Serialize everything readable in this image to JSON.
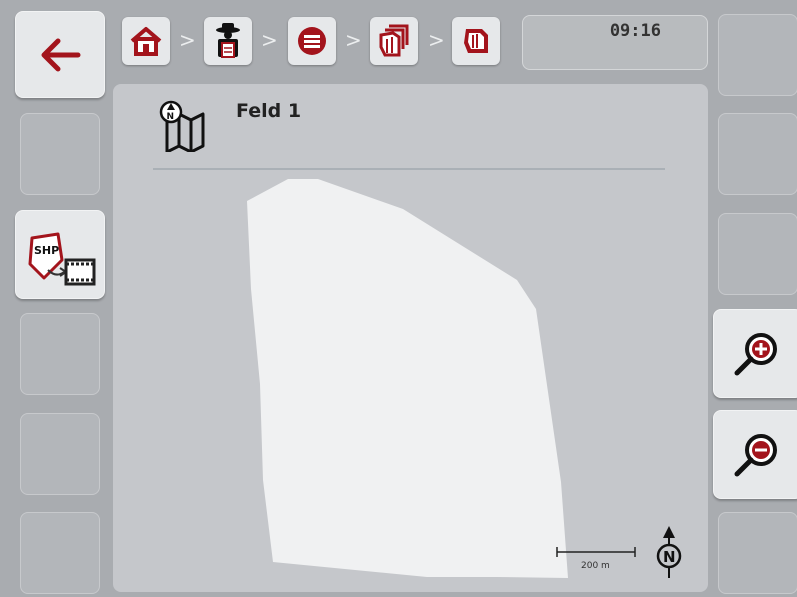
{
  "header": {
    "time": "09:16"
  },
  "field": {
    "name": "Feld 1"
  },
  "map": {
    "scale_label": "200 m",
    "north_label": "N"
  },
  "icons": {
    "shp_label": "SHP",
    "breadcrumb": [
      "home-icon",
      "farmer-icon",
      "list-menu-icon",
      "fields-icon",
      "field-icon"
    ]
  },
  "colors": {
    "accent": "#a3141c",
    "field": "#f0f1f2",
    "panel": "#c5c7cb"
  }
}
